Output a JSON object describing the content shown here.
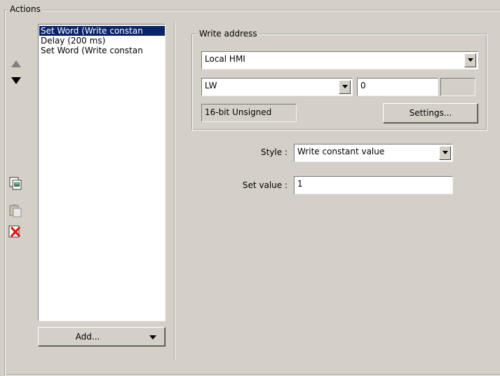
{
  "actions_group": {
    "title": "Actions"
  },
  "actions_list": {
    "items": [
      {
        "label": "Set Word (Write constan",
        "selected": true
      },
      {
        "label": "Delay (200 ms)",
        "selected": false
      },
      {
        "label": "Set Word (Write constan",
        "selected": false
      }
    ],
    "add_label": "Add..."
  },
  "write_address": {
    "title": "Write address",
    "device_value": "Local HMI",
    "register_value": "LW",
    "address_value": "0",
    "address_extra": "",
    "data_format": "16-bit Unsigned",
    "settings_label": "Settings..."
  },
  "style": {
    "label": "Style :",
    "value": "Write constant value"
  },
  "set_value": {
    "label": "Set value :",
    "value": "1"
  },
  "icons": {
    "move_up": "move-up-icon",
    "move_down": "move-down-icon",
    "copy": "copy-icon",
    "paste": "paste-icon",
    "delete": "delete-icon"
  }
}
